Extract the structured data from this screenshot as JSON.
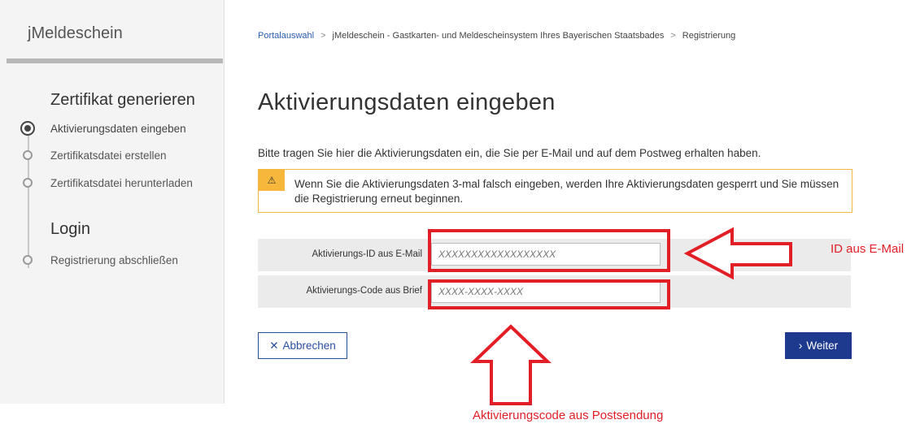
{
  "sidebar": {
    "app_title": "jMeldeschein",
    "sections": [
      {
        "heading": "Zertifikat generieren",
        "steps": [
          "Aktivierungsdaten eingeben",
          "Zertifikatsdatei erstellen",
          "Zertifikatsdatei herunterladen"
        ]
      },
      {
        "heading": "Login",
        "steps": [
          "Registrierung abschließen"
        ]
      }
    ]
  },
  "breadcrumb": {
    "items": [
      "Portalauswahl",
      "jMeldeschein - Gastkarten- und Meldescheinsystem Ihres Bayerischen Staatsbades",
      "Registrierung"
    ],
    "separator": ">"
  },
  "main": {
    "title": "Aktivierungsdaten eingeben",
    "intro": "Bitte tragen Sie hier die Aktivierungsdaten ein, die Sie per E-Mail und auf dem Postweg erhalten haben.",
    "warning": "Wenn Sie die Aktivierungsdaten 3-mal falsch eingeben, werden Ihre Aktivierungsdaten gesperrt und Sie müssen die Registrierung erneut beginnen."
  },
  "form": {
    "id_label": "Aktivierungs-ID aus E-Mail",
    "id_placeholder": "XXXXXXXXXXXXXXXXXX",
    "code_label": "Aktivierungs-Code aus Brief",
    "code_placeholder": "XXXX-XXXX-XXXX"
  },
  "buttons": {
    "cancel": "Abbrechen",
    "next": "Weiter"
  },
  "annotations": {
    "id_note": "ID aus E-Mail",
    "code_note": "Aktivierungscode aus Postsendung",
    "color": "#e21e26"
  },
  "icons": {
    "warning": "warning-icon",
    "close": "close-icon",
    "chevron": "chevron-right-icon",
    "step_active": "radio-active-icon",
    "step": "step-dot-icon"
  }
}
